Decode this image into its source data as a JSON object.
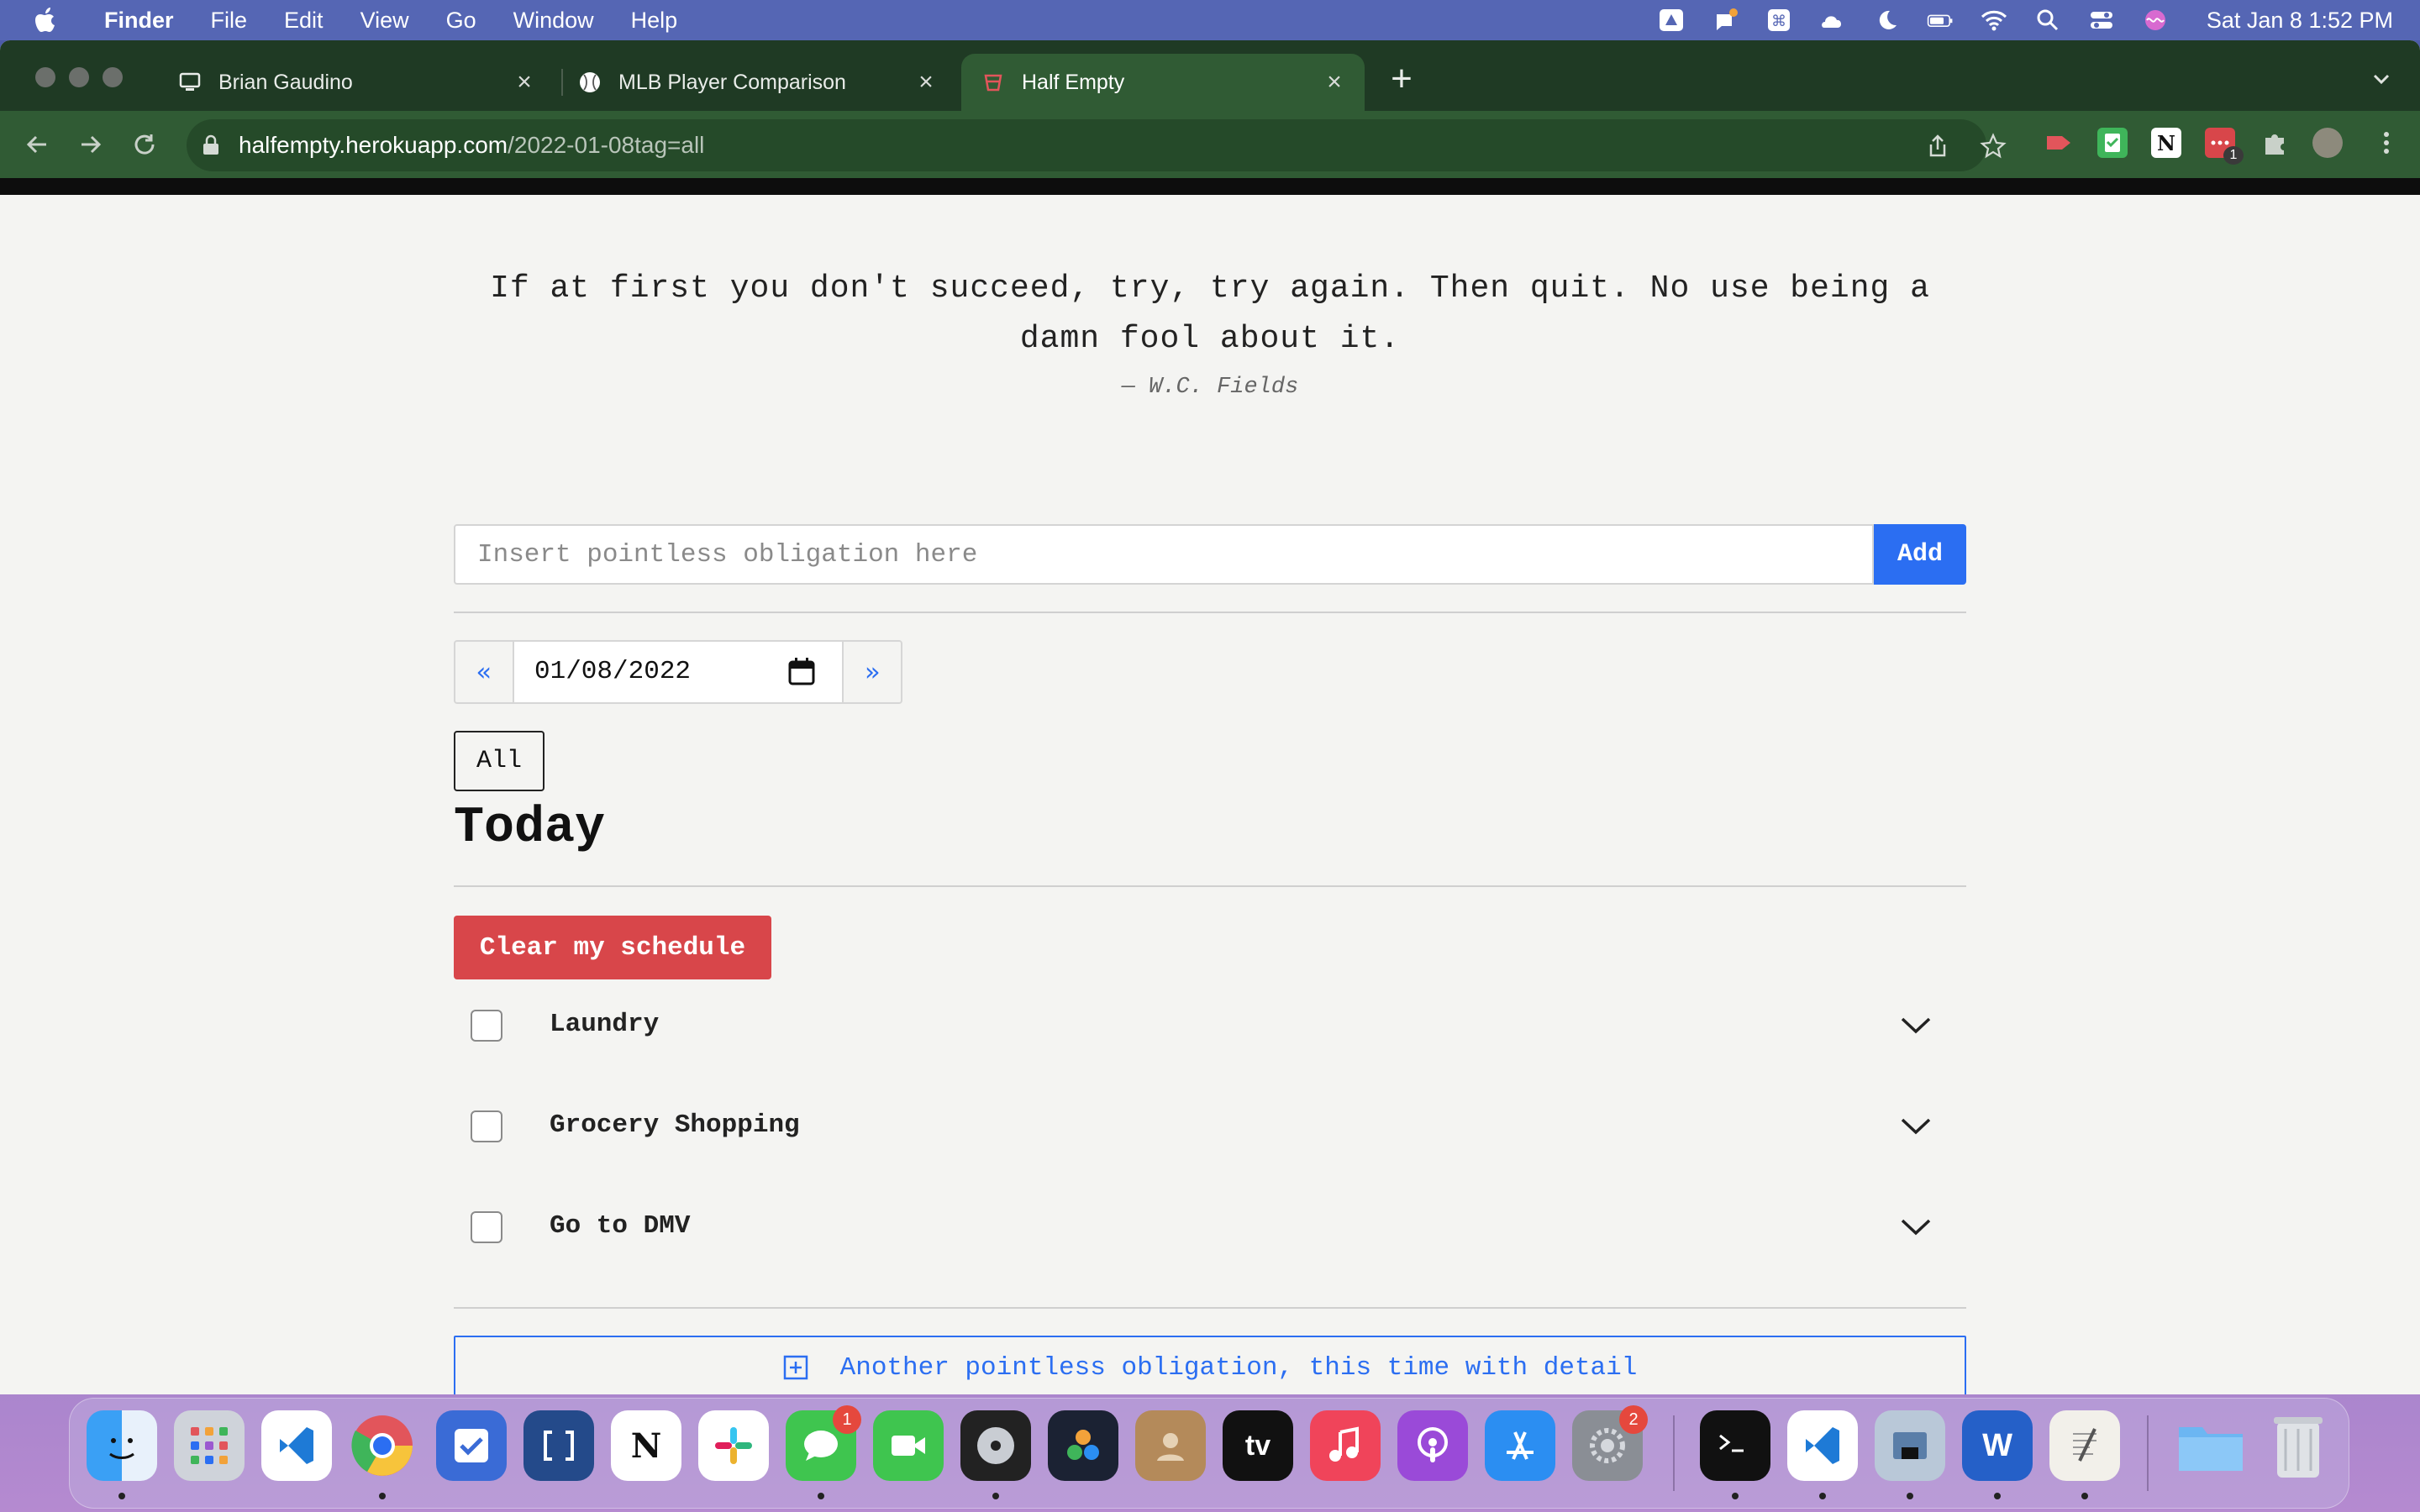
{
  "menubar": {
    "app_name": "Finder",
    "items": [
      "File",
      "Edit",
      "View",
      "Go",
      "Window",
      "Help"
    ],
    "clock": "Sat Jan 8  1:52 PM"
  },
  "browser": {
    "tabs": [
      {
        "title": "Brian Gaudino",
        "icon": "monitor-icon"
      },
      {
        "title": "MLB Player Comparison",
        "icon": "baseball-icon"
      },
      {
        "title": "Half Empty",
        "icon": "glass-icon"
      }
    ],
    "url_host": "halfempty.herokuapp.com",
    "url_path": "/2022-01-08tag=all",
    "extension_badge": "1"
  },
  "page": {
    "quote": "If at first you don't succeed, try, try again. Then quit. No use being a damn fool about it.",
    "author": "—  W.C. Fields",
    "add_placeholder": "Insert pointless obligation here",
    "add_label": "Add",
    "date_prev": "«",
    "date_value": "01/08/2022",
    "date_next": "»",
    "tag_label": "All",
    "heading": "Today",
    "clear_label": "Clear my schedule",
    "tasks": [
      {
        "label": "Laundry"
      },
      {
        "label": "Grocery Shopping"
      },
      {
        "label": "Go to DMV"
      }
    ],
    "detail_label": "Another pointless obligation, this time with detail"
  },
  "dock": {
    "messages_badge": "1",
    "settings_badge": "2"
  },
  "colors": {
    "accent": "#2b6ef2",
    "danger": "#d8464a",
    "tab_bar": "#1f3a24",
    "toolbar": "#305b34"
  }
}
